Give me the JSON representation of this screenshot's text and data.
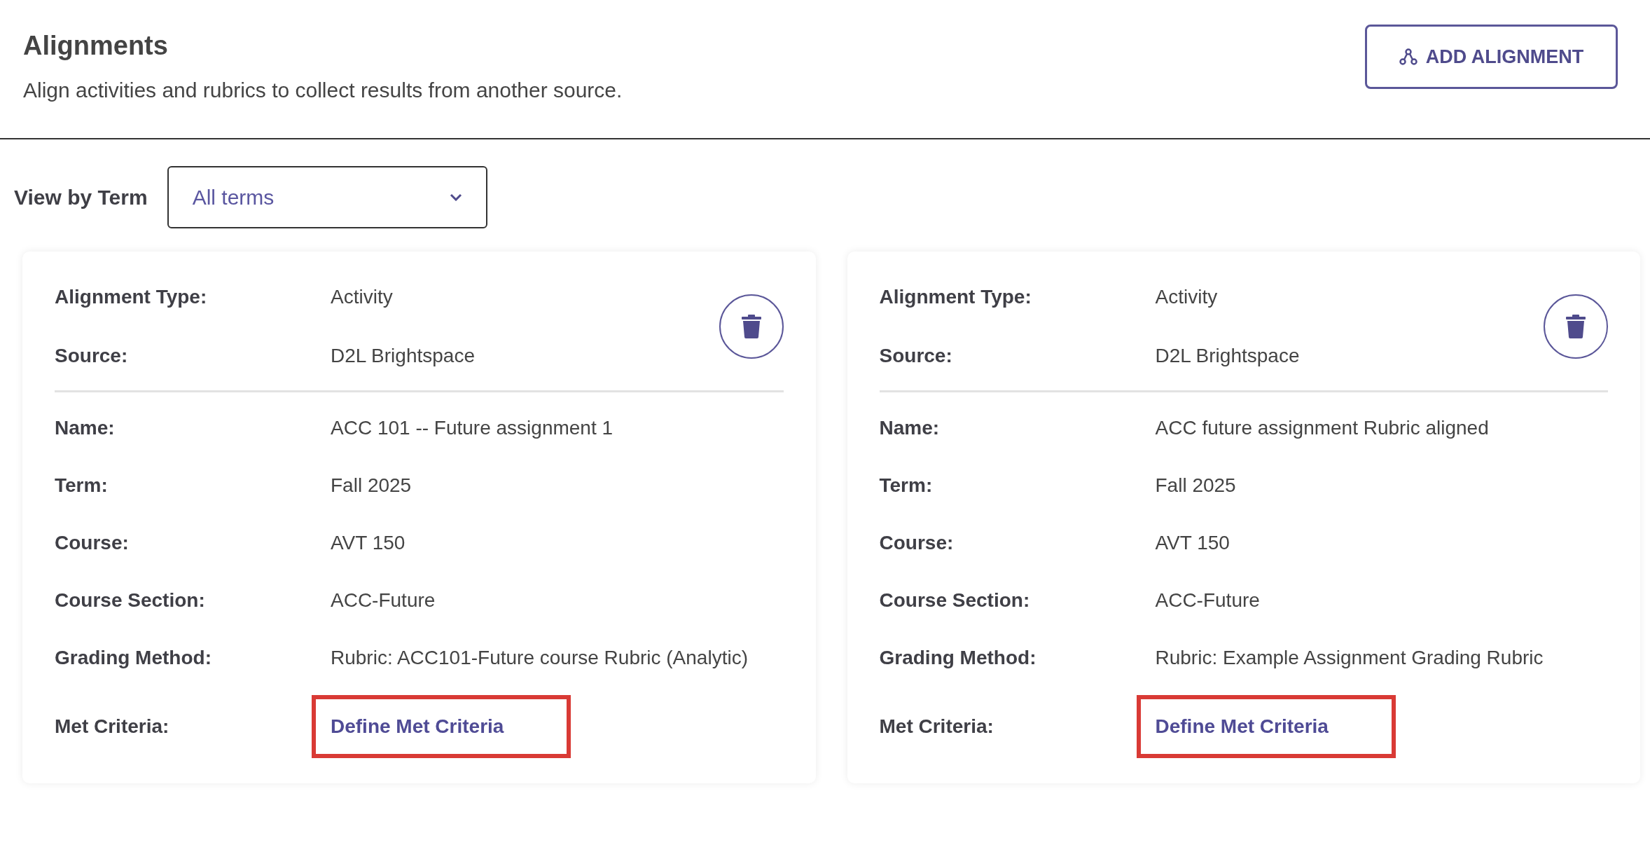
{
  "header": {
    "title": "Alignments",
    "subtitle": "Align activities and rubrics to collect results from another source.",
    "add_button": "ADD ALIGNMENT"
  },
  "filter": {
    "label": "View by Term",
    "value": "All terms"
  },
  "cards": [
    {
      "top_fields": [
        {
          "label": "Alignment Type:",
          "value": "Activity"
        },
        {
          "label": "Source:",
          "value": "D2L Brightspace"
        }
      ],
      "fields": [
        {
          "label": "Name:",
          "value": "ACC 101 -- Future assignment 1"
        },
        {
          "label": "Term:",
          "value": "Fall 2025"
        },
        {
          "label": "Course:",
          "value": "AVT 150"
        },
        {
          "label": "Course Section:",
          "value": "ACC-Future"
        },
        {
          "label": "Grading Method:",
          "value": "Rubric: ACC101-Future course Rubric (Analytic)"
        }
      ],
      "met_criteria": {
        "label": "Met Criteria:",
        "link": "Define Met Criteria",
        "highlighted": true
      }
    },
    {
      "top_fields": [
        {
          "label": "Alignment Type:",
          "value": "Activity"
        },
        {
          "label": "Source:",
          "value": "D2L Brightspace"
        }
      ],
      "fields": [
        {
          "label": "Name:",
          "value": "ACC future assignment Rubric aligned"
        },
        {
          "label": "Term:",
          "value": "Fall 2025"
        },
        {
          "label": "Course:",
          "value": "AVT 150"
        },
        {
          "label": "Course Section:",
          "value": "ACC-Future"
        },
        {
          "label": "Grading Method:",
          "value": "Rubric: Example Assignment Grading Rubric"
        }
      ],
      "met_criteria": {
        "label": "Met Criteria:",
        "link": "Define Met Criteria",
        "highlighted": true
      }
    }
  ]
}
